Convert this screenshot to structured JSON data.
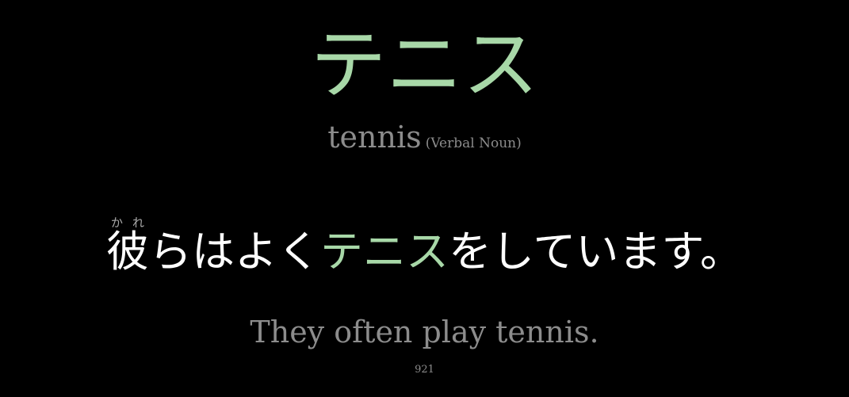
{
  "card": {
    "word": "テニス",
    "meaning": "tennis",
    "part_of_speech": "(Verbal Noun)",
    "sentence": {
      "first_kanji": "彼",
      "first_kanji_reading": "かれ",
      "before": "らはよく",
      "highlight": "テニス",
      "after": "をしています。"
    },
    "translation": "They often play tennis.",
    "index": "921"
  },
  "colors": {
    "background": "#000000",
    "accent_green": "#a8d8a8",
    "sentence_text": "#ffffff",
    "muted_text": "#8c8c8c"
  }
}
